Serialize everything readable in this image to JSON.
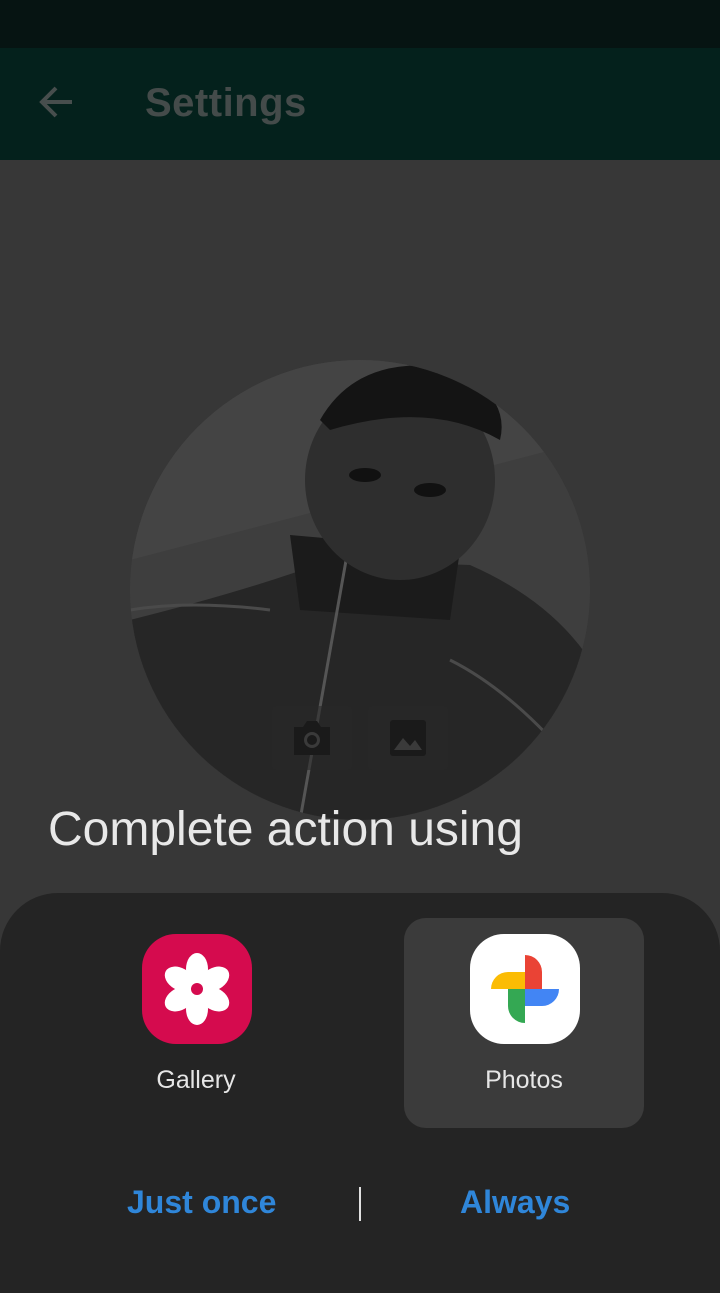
{
  "app_bar": {
    "title": "Settings",
    "back_icon": "arrow-back-icon"
  },
  "profile": {
    "camera_icon": "camera-icon",
    "gallery_icon": "image-icon"
  },
  "chooser": {
    "title": "Complete action using",
    "apps": [
      {
        "label": "Gallery",
        "icon": "gallery-flower-icon",
        "icon_bg": "#d50b4e",
        "selected": false
      },
      {
        "label": "Photos",
        "icon": "google-photos-pinwheel-icon",
        "icon_bg": "#ffffff",
        "selected": true
      }
    ],
    "buttons": {
      "just_once": "Just once",
      "always": "Always"
    }
  },
  "colors": {
    "accent": "#2f86d9",
    "sheet": "#242424",
    "app_bar": "#04211c"
  }
}
